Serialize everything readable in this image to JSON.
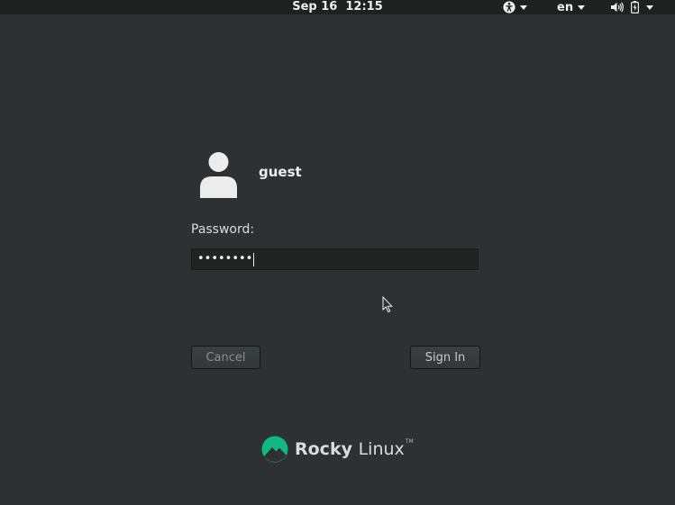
{
  "topbar": {
    "clock_date": "Sep 16",
    "clock_time": "12:15",
    "language": "en"
  },
  "login": {
    "username": "guest",
    "password_label": "Password:",
    "password_masked": "••••••••",
    "cancel_label": "Cancel",
    "signin_label": "Sign In"
  },
  "branding": {
    "logo_word_1": "Rocky",
    "logo_word_2": "Linux",
    "trademark": "TM",
    "accent_color": "#10b981"
  },
  "icons": {
    "accessibility": "accessibility-icon",
    "volume": "volume-icon",
    "battery": "battery-icon",
    "avatar": "user-avatar-icon",
    "pointer": "mouse-pointer-icon",
    "logo": "rocky-logo-icon"
  }
}
